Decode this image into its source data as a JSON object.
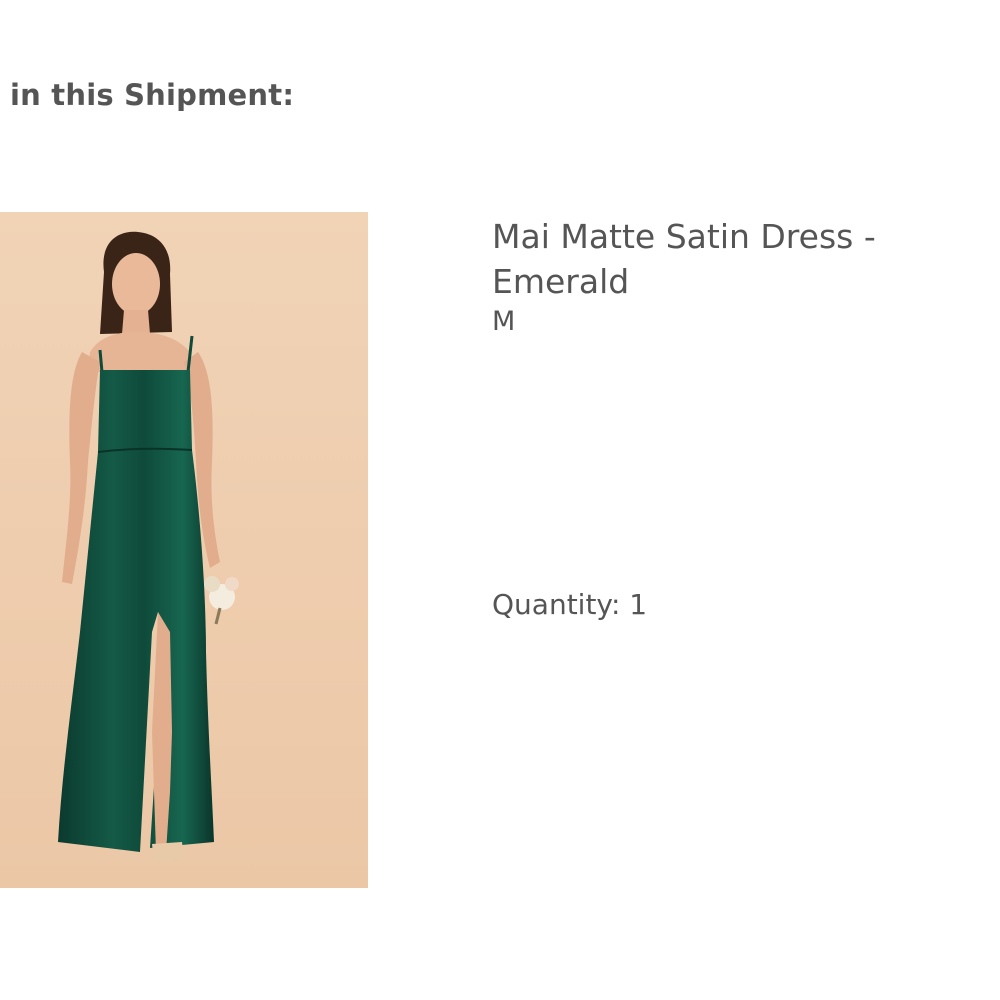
{
  "shipment": {
    "heading": "in this Shipment:"
  },
  "item": {
    "name": "Mai Matte Satin Dress - Emerald",
    "size": "M",
    "quantity_label": "Quantity: 1",
    "image": {
      "icon": "dress-photo",
      "background_color": "#efcfb0",
      "dress_color": "#0f4a3a"
    }
  }
}
